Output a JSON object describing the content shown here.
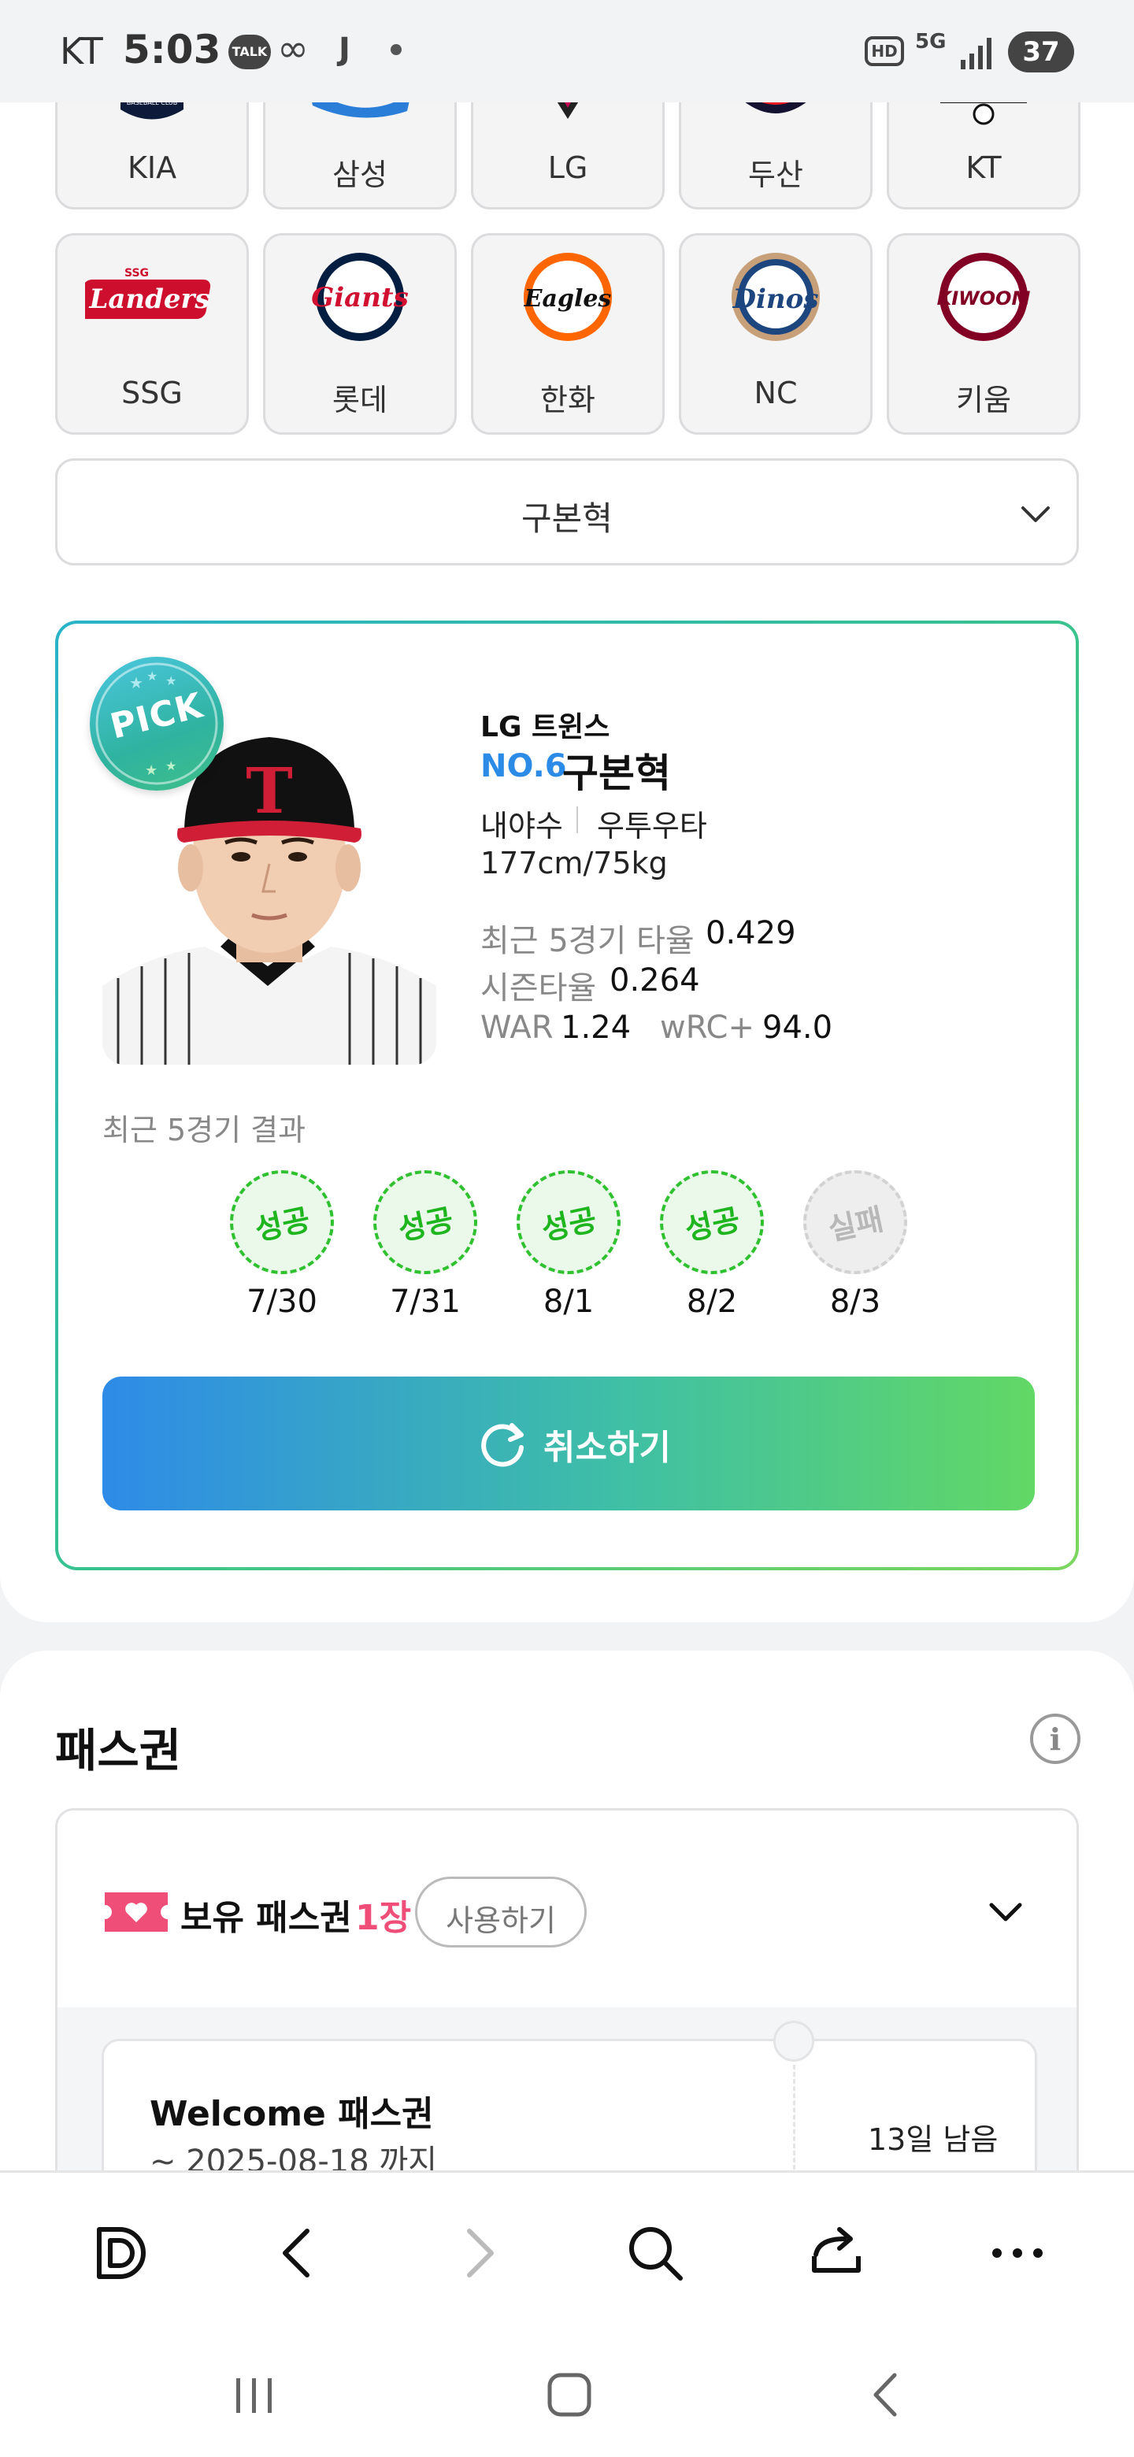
{
  "status_bar": {
    "carrier": "KT",
    "time": "5:03",
    "talk_badge": "TALK",
    "hd_badge": "HD",
    "network": "5G",
    "battery": "37"
  },
  "teams": [
    {
      "name": "KIA"
    },
    {
      "name": "삼성"
    },
    {
      "name": "LG"
    },
    {
      "name": "두산"
    },
    {
      "name": "KT"
    },
    {
      "name": "SSG",
      "logo_text": "Landers"
    },
    {
      "name": "롯데",
      "logo_text": "Giants"
    },
    {
      "name": "한화",
      "logo_text": "Eagles"
    },
    {
      "name": "NC",
      "logo_text": "Dinos"
    },
    {
      "name": "키움",
      "logo_text": "KIWOOM"
    }
  ],
  "player_select": {
    "value": "구본혁",
    "icon": "chevron-down-icon"
  },
  "player_card": {
    "pick_badge": "PICK",
    "team": "LG 트윈스",
    "number": "NO.6",
    "name": "구본혁",
    "position": "내야수",
    "handedness": "우투우타",
    "body": "177cm/75kg",
    "stats": {
      "recent5_label": "최근 5경기 타율",
      "recent5_value": "0.429",
      "season_label": "시즌타율",
      "season_value": "0.264",
      "war_label": "WAR",
      "war_value": "1.24",
      "wrc_label": "wRC+",
      "wrc_value": "94.0"
    },
    "results_title": "최근 5경기 결과",
    "results": [
      {
        "status": "성공",
        "date": "7/30",
        "success": true
      },
      {
        "status": "성공",
        "date": "7/31",
        "success": true
      },
      {
        "status": "성공",
        "date": "8/1",
        "success": true
      },
      {
        "status": "성공",
        "date": "8/2",
        "success": true
      },
      {
        "status": "실패",
        "date": "8/3",
        "success": false
      }
    ],
    "cancel_label": "취소하기"
  },
  "pass_section": {
    "title": "패스권",
    "owned_label": "보유 패스권",
    "owned_count": "1장",
    "use_button": "사용하기",
    "coupon": {
      "name": "Welcome 패스권",
      "expiry": "~ 2025-08-18 까지",
      "remaining": "13일 남음"
    }
  },
  "colors": {
    "accent_blue": "#2e8be8",
    "accent_green": "#62d865",
    "success_green": "#1fb51f",
    "pass_pink": "#ee4e78"
  }
}
